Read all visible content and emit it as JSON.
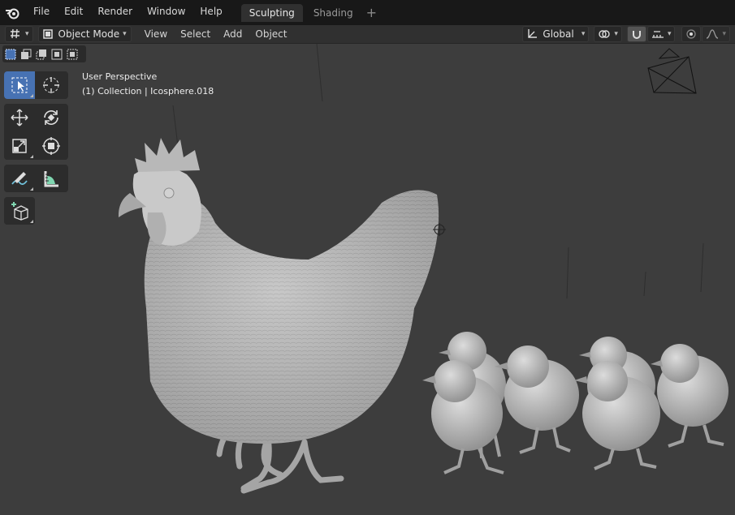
{
  "menubar": {
    "items": [
      "File",
      "Edit",
      "Render",
      "Window",
      "Help"
    ],
    "workspaces": [
      {
        "label": "Sculpting",
        "active": true
      },
      {
        "label": "Shading",
        "active": false
      }
    ],
    "add_tab": "+"
  },
  "header": {
    "mode_label": "Object Mode",
    "menus": [
      "View",
      "Select",
      "Add",
      "Object"
    ],
    "transform_orientation": "Global"
  },
  "viewport": {
    "perspective_label": "User Perspective",
    "collection_label": "(1) Collection | Icosphere.018"
  },
  "icons": {
    "logo": "blender-logo-icon",
    "editor": "editor-type-icon",
    "select": "select-box-icon",
    "cursor": "cursor-icon",
    "move": "move-icon",
    "rotate": "rotate-icon",
    "scale": "scale-icon",
    "transform": "transform-icon",
    "annotate": "annotate-icon",
    "measure": "measure-icon",
    "add_cube": "add-cube-icon"
  },
  "colors": {
    "topbar": "#181818",
    "header": "#303030",
    "viewport": "#3d3d3d",
    "active_tool": "#4772b3",
    "model": "#bdbdbd"
  }
}
